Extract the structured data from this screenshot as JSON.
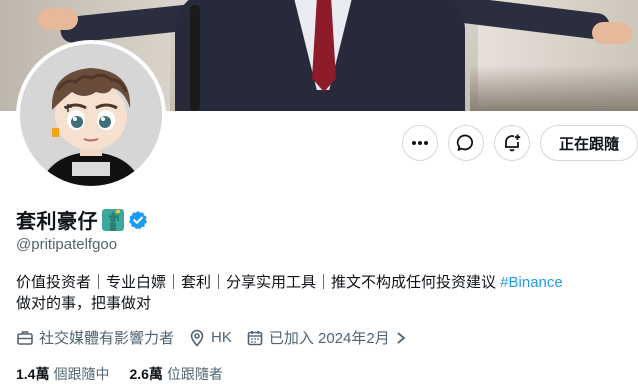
{
  "profile": {
    "name": "套利豪仔",
    "handle": "@pritipatelfgoo",
    "bio_text": "价值投资者｜专业白嫖｜套利｜分享实用工具｜推文不构成任何投资建议 ",
    "bio_hashtag": "#Binance",
    "bio_line2": "做对的事，把事做对",
    "category": "社交媒體有影響力者",
    "location": "HK",
    "joined": "已加入 2024年2月",
    "following_count": "1.4萬",
    "following_label": "個跟隨中",
    "followers_count": "2.6萬",
    "followers_label": "位跟隨者"
  },
  "actions": {
    "more_icon": "more-icon",
    "message_icon": "message-icon",
    "notify_icon": "bell-plus-icon",
    "following_label": "正在跟隨"
  },
  "colors": {
    "accent": "#1d9bf0",
    "secondary_text": "#536471",
    "border": "#cfd9de"
  }
}
